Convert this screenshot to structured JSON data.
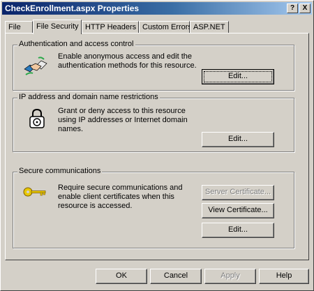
{
  "window": {
    "title": "CheckEnrollment.aspx Properties",
    "help_glyph": "?",
    "close_glyph": "X"
  },
  "tabs": [
    "File",
    "File Security",
    "HTTP Headers",
    "Custom Errors",
    "ASP.NET"
  ],
  "active_tab": "File Security",
  "auth": {
    "label": "Authentication and access control",
    "text": "Enable anonymous access and edit the authentication methods for this resource.",
    "edit": "Edit...",
    "icon": "handshake-icon"
  },
  "ip": {
    "label": "IP address and domain name restrictions",
    "text": "Grant or deny access to this resource using IP addresses or Internet domain names.",
    "edit": "Edit...",
    "icon": "padlock-icon"
  },
  "secure": {
    "label": "Secure communications",
    "text": "Require secure communications and enable client certificates when this resource is accessed.",
    "server_cert": "Server Certificate...",
    "view_cert": "View Certificate...",
    "edit": "Edit...",
    "icon": "key-icon"
  },
  "footer": {
    "ok": "OK",
    "cancel": "Cancel",
    "apply": "Apply",
    "help": "Help"
  },
  "colors": {
    "titlebar_start": "#0a246a",
    "titlebar_end": "#a6caf0",
    "face": "#d4d0c8"
  }
}
